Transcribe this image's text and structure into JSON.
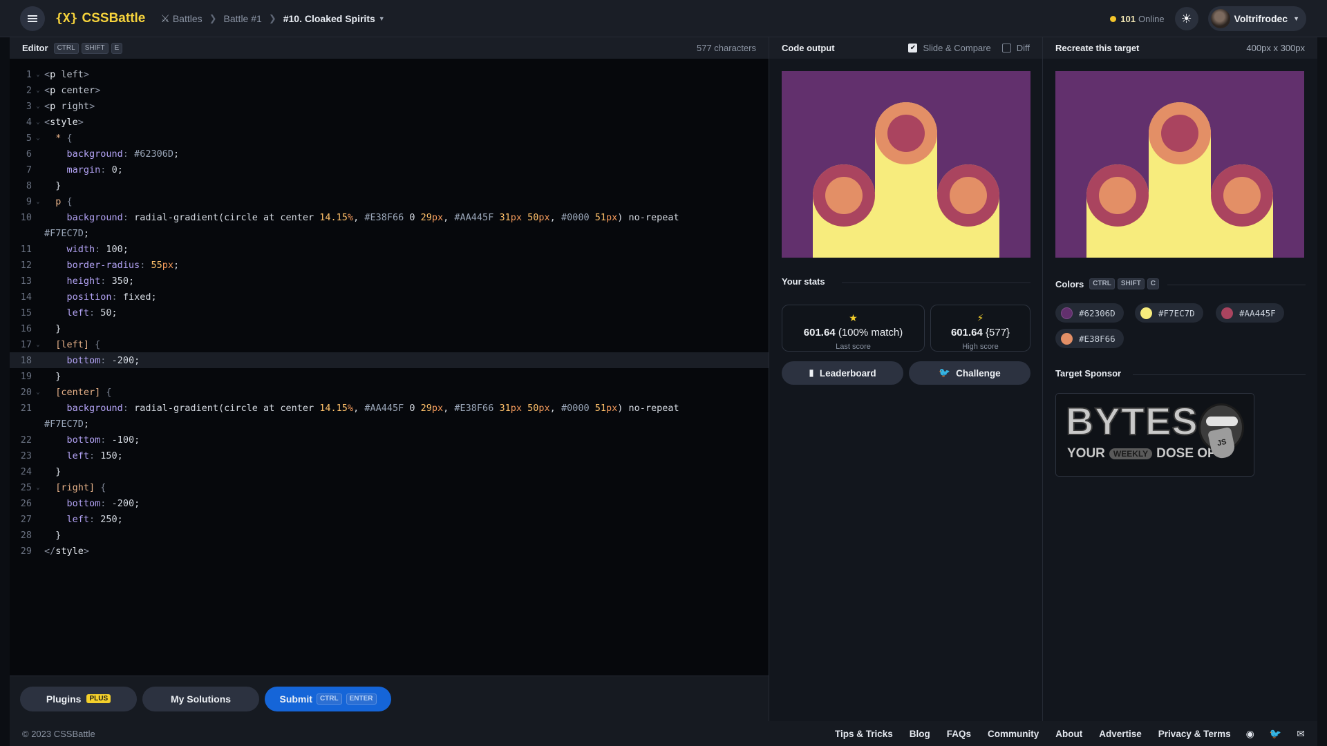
{
  "header": {
    "logo": "CSSBattle",
    "logo_mark": "{X}",
    "breadcrumbs": [
      "Battles",
      "Battle #1",
      "#10. Cloaked Spirits"
    ],
    "online_count": "101",
    "online_label": "Online",
    "username": "Voltrifrodec"
  },
  "editor": {
    "title": "Editor",
    "shortcut": [
      "CTRL",
      "SHIFT",
      "E"
    ],
    "char_count": "577 characters",
    "lines": [
      "<p left>",
      "<p center>",
      "<p right>",
      "<style>",
      "  * {",
      "    background: #62306D;",
      "    margin: 0;",
      "  }",
      "  p {",
      "    background: radial-gradient(circle at center 14.15%, #E38F66 0 29px, #AA445F 31px 50px, #0000 51px) no-repeat",
      "#F7EC7D;",
      "    width: 100;",
      "    border-radius: 55px;",
      "    height: 350;",
      "    position: fixed;",
      "    left: 50;",
      "  }",
      "  [left] {",
      "    bottom: -200;",
      "  }",
      "  [center] {",
      "    background: radial-gradient(circle at center 14.15%, #AA445F 0 29px, #E38F66 31px 50px, #0000 51px) no-repeat",
      "#F7EC7D;",
      "    bottom: -100;",
      "    left: 150;",
      "  }",
      "  [right] {",
      "    bottom: -200;",
      "    left: 250;",
      "  }",
      "</style>"
    ],
    "line_numbers": [
      "1",
      "2",
      "3",
      "4",
      "5",
      "6",
      "7",
      "8",
      "9",
      "10",
      "",
      "11",
      "12",
      "13",
      "14",
      "15",
      "16",
      "17",
      "18",
      "19",
      "20",
      "21",
      "",
      "22",
      "23",
      "24",
      "25",
      "26",
      "27",
      "28",
      "29"
    ],
    "highlighted_line": "18"
  },
  "footer_buttons": {
    "plugins": "Plugins",
    "plus_badge": "PLUS",
    "my_solutions": "My Solutions",
    "submit": "Submit",
    "submit_keys": [
      "CTRL",
      "ENTER"
    ]
  },
  "output": {
    "title": "Code output",
    "slide_compare": "Slide & Compare",
    "slide_compare_checked": true,
    "diff": "Diff",
    "diff_checked": false
  },
  "stats": {
    "title": "Your stats",
    "last_score": "601.64",
    "last_match": "(100% match)",
    "last_label": "Last score",
    "high_score": "601.64",
    "high_chars": "{577}",
    "high_label": "High score",
    "leaderboard": "Leaderboard",
    "challenge": "Challenge"
  },
  "target": {
    "title": "Recreate this target",
    "dims": "400px x 300px",
    "colors_title": "Colors",
    "colors_shortcut": [
      "CTRL",
      "SHIFT",
      "C"
    ],
    "colors": [
      "#62306D",
      "#F7EC7D",
      "#AA445F",
      "#E38F66"
    ],
    "sponsor_title": "Target Sponsor",
    "sponsor_big": "BYTES",
    "sponsor_your": "YOUR",
    "sponsor_weekly": "WEEKLY",
    "sponsor_dose": "DOSE OF",
    "sponsor_js": "JS"
  },
  "footer": {
    "copyright": "© 2023 CSSBattle",
    "links": [
      "Tips & Tricks",
      "Blog",
      "FAQs",
      "Community",
      "About",
      "Advertise",
      "Privacy & Terms"
    ]
  },
  "palette": {
    "bg": "#62306D",
    "yellow": "#F7EC7D",
    "red": "#AA445F",
    "orange": "#E38F66",
    "accent": "#F6D33C",
    "submit": "#1565D8"
  }
}
